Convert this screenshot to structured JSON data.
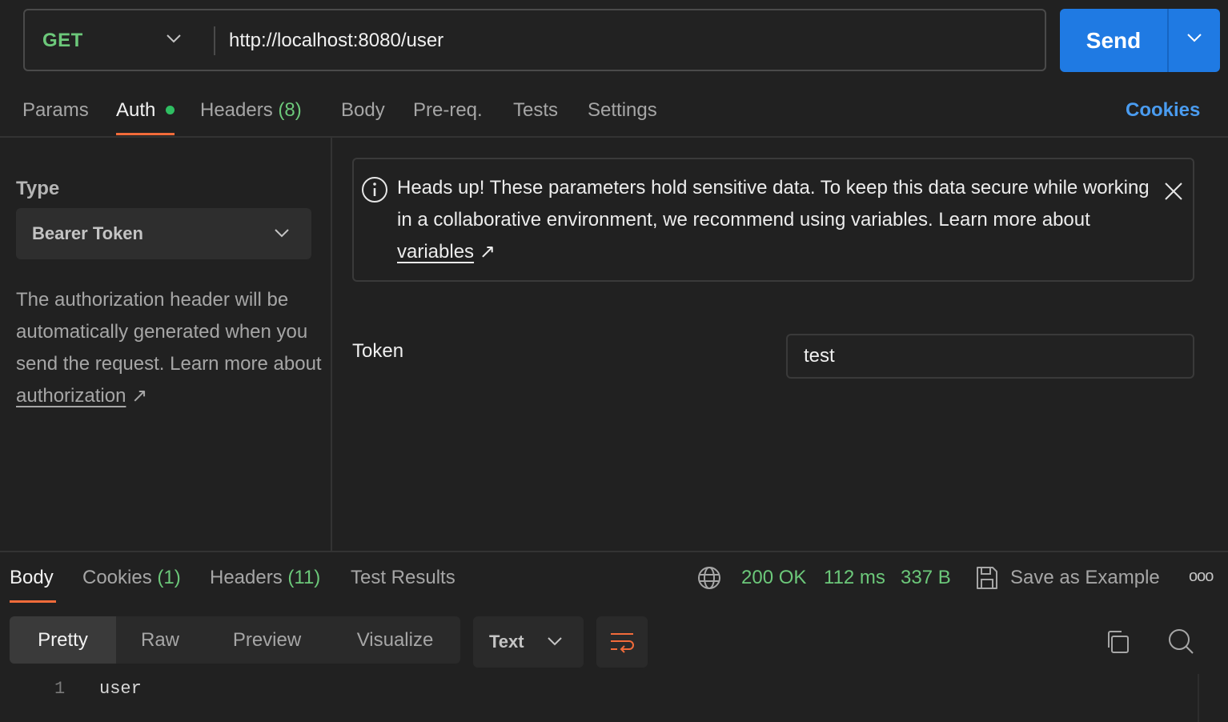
{
  "request": {
    "method": "GET",
    "url": "http://localhost:8080/user",
    "send_label": "Send"
  },
  "request_tabs": [
    {
      "label": "Params"
    },
    {
      "label": "Auth"
    },
    {
      "label": "Headers",
      "count": "(8)"
    },
    {
      "label": "Body"
    },
    {
      "label": "Pre-req."
    },
    {
      "label": "Tests"
    },
    {
      "label": "Settings"
    }
  ],
  "cookies_link": "Cookies",
  "auth": {
    "type_label": "Type",
    "type_value": "Bearer Token",
    "description": "The authorization header will be automatically generated when you send the request. Learn more about ",
    "description_link": "authorization",
    "arrow": "↗"
  },
  "banner": {
    "text": "Heads up! These parameters hold sensitive data. To keep this data secure while working in a collaborative environment, we recommend using variables. Learn more about ",
    "link": "variables",
    "arrow": "↗"
  },
  "token": {
    "label": "Token",
    "value": "test"
  },
  "response_tabs": [
    {
      "label": "Body"
    },
    {
      "label": "Cookies",
      "count": "(1)"
    },
    {
      "label": "Headers",
      "count": "(11)"
    },
    {
      "label": "Test Results"
    }
  ],
  "response_status": {
    "code": "200 OK",
    "time": "112 ms",
    "size": "337 B"
  },
  "save_example_label": "Save as Example",
  "more_label": "ooo",
  "view_modes": [
    "Pretty",
    "Raw",
    "Preview",
    "Visualize"
  ],
  "format": "Text",
  "code_lines": [
    {
      "number": "1",
      "text": "user"
    }
  ],
  "colors": {
    "accent_blue": "#1f7ae3",
    "tab_indicator": "#f26b3a",
    "status_green": "#6cc87a",
    "link_blue": "#4a9cf0"
  }
}
